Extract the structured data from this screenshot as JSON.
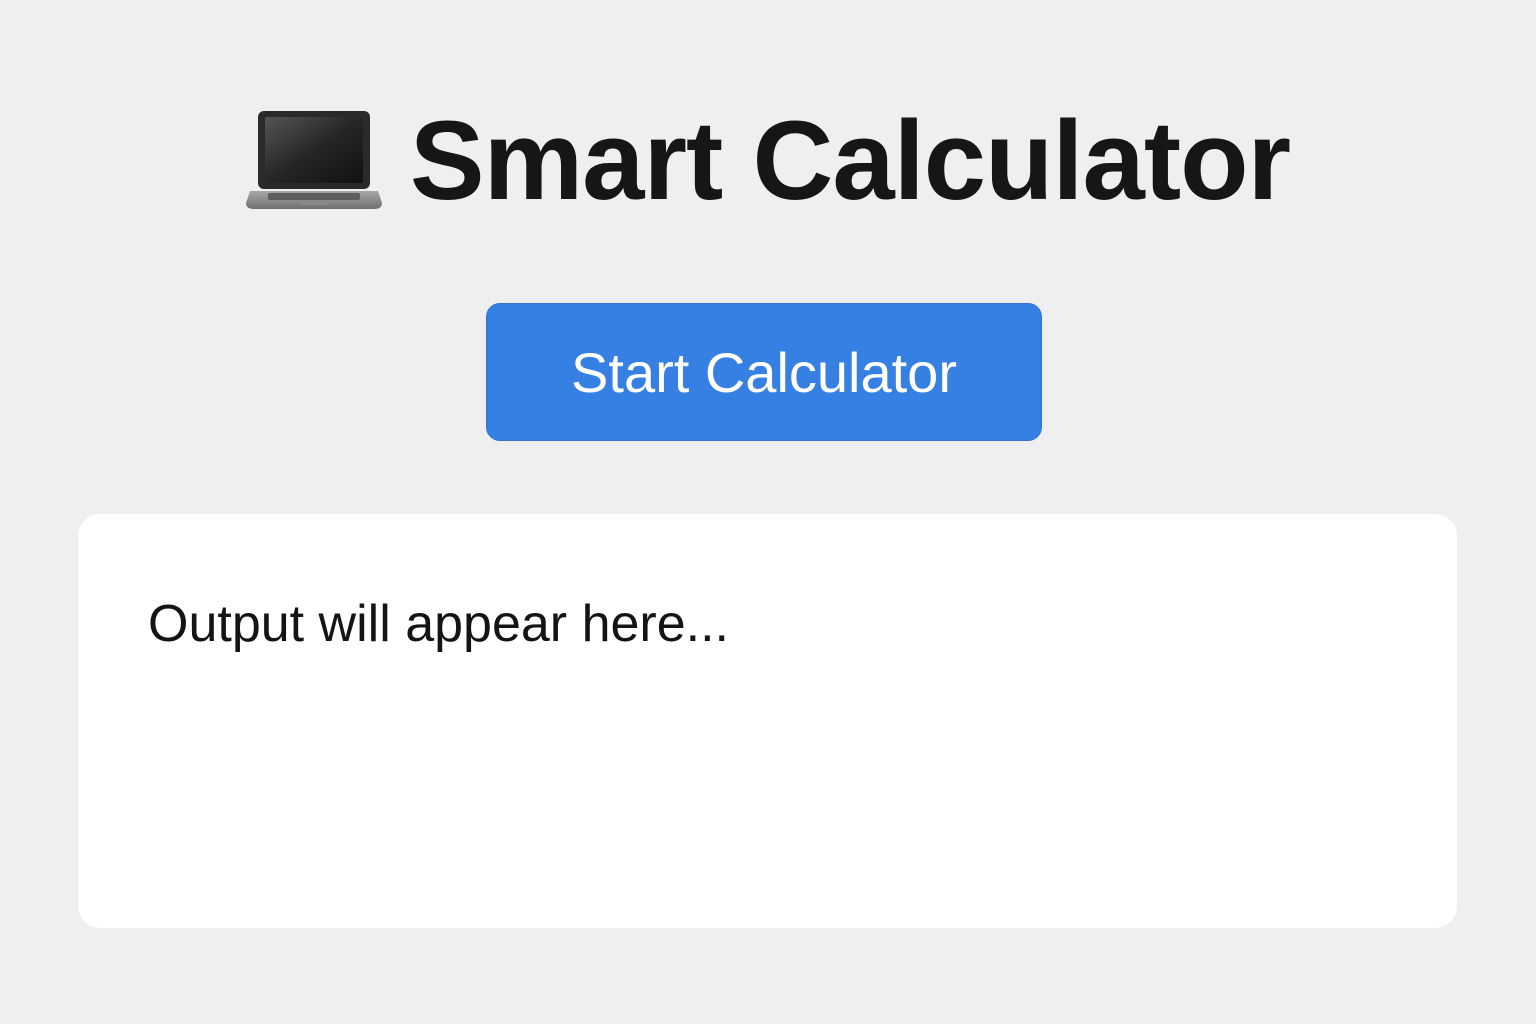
{
  "header": {
    "icon": "laptop-icon",
    "title": "Smart Calculator"
  },
  "actions": {
    "start_label": "Start Calculator",
    "start_color": "#3680e4"
  },
  "output": {
    "text": "Output will appear here..."
  },
  "colors": {
    "background": "#efefef",
    "panel": "#ffffff",
    "text": "#161616"
  }
}
